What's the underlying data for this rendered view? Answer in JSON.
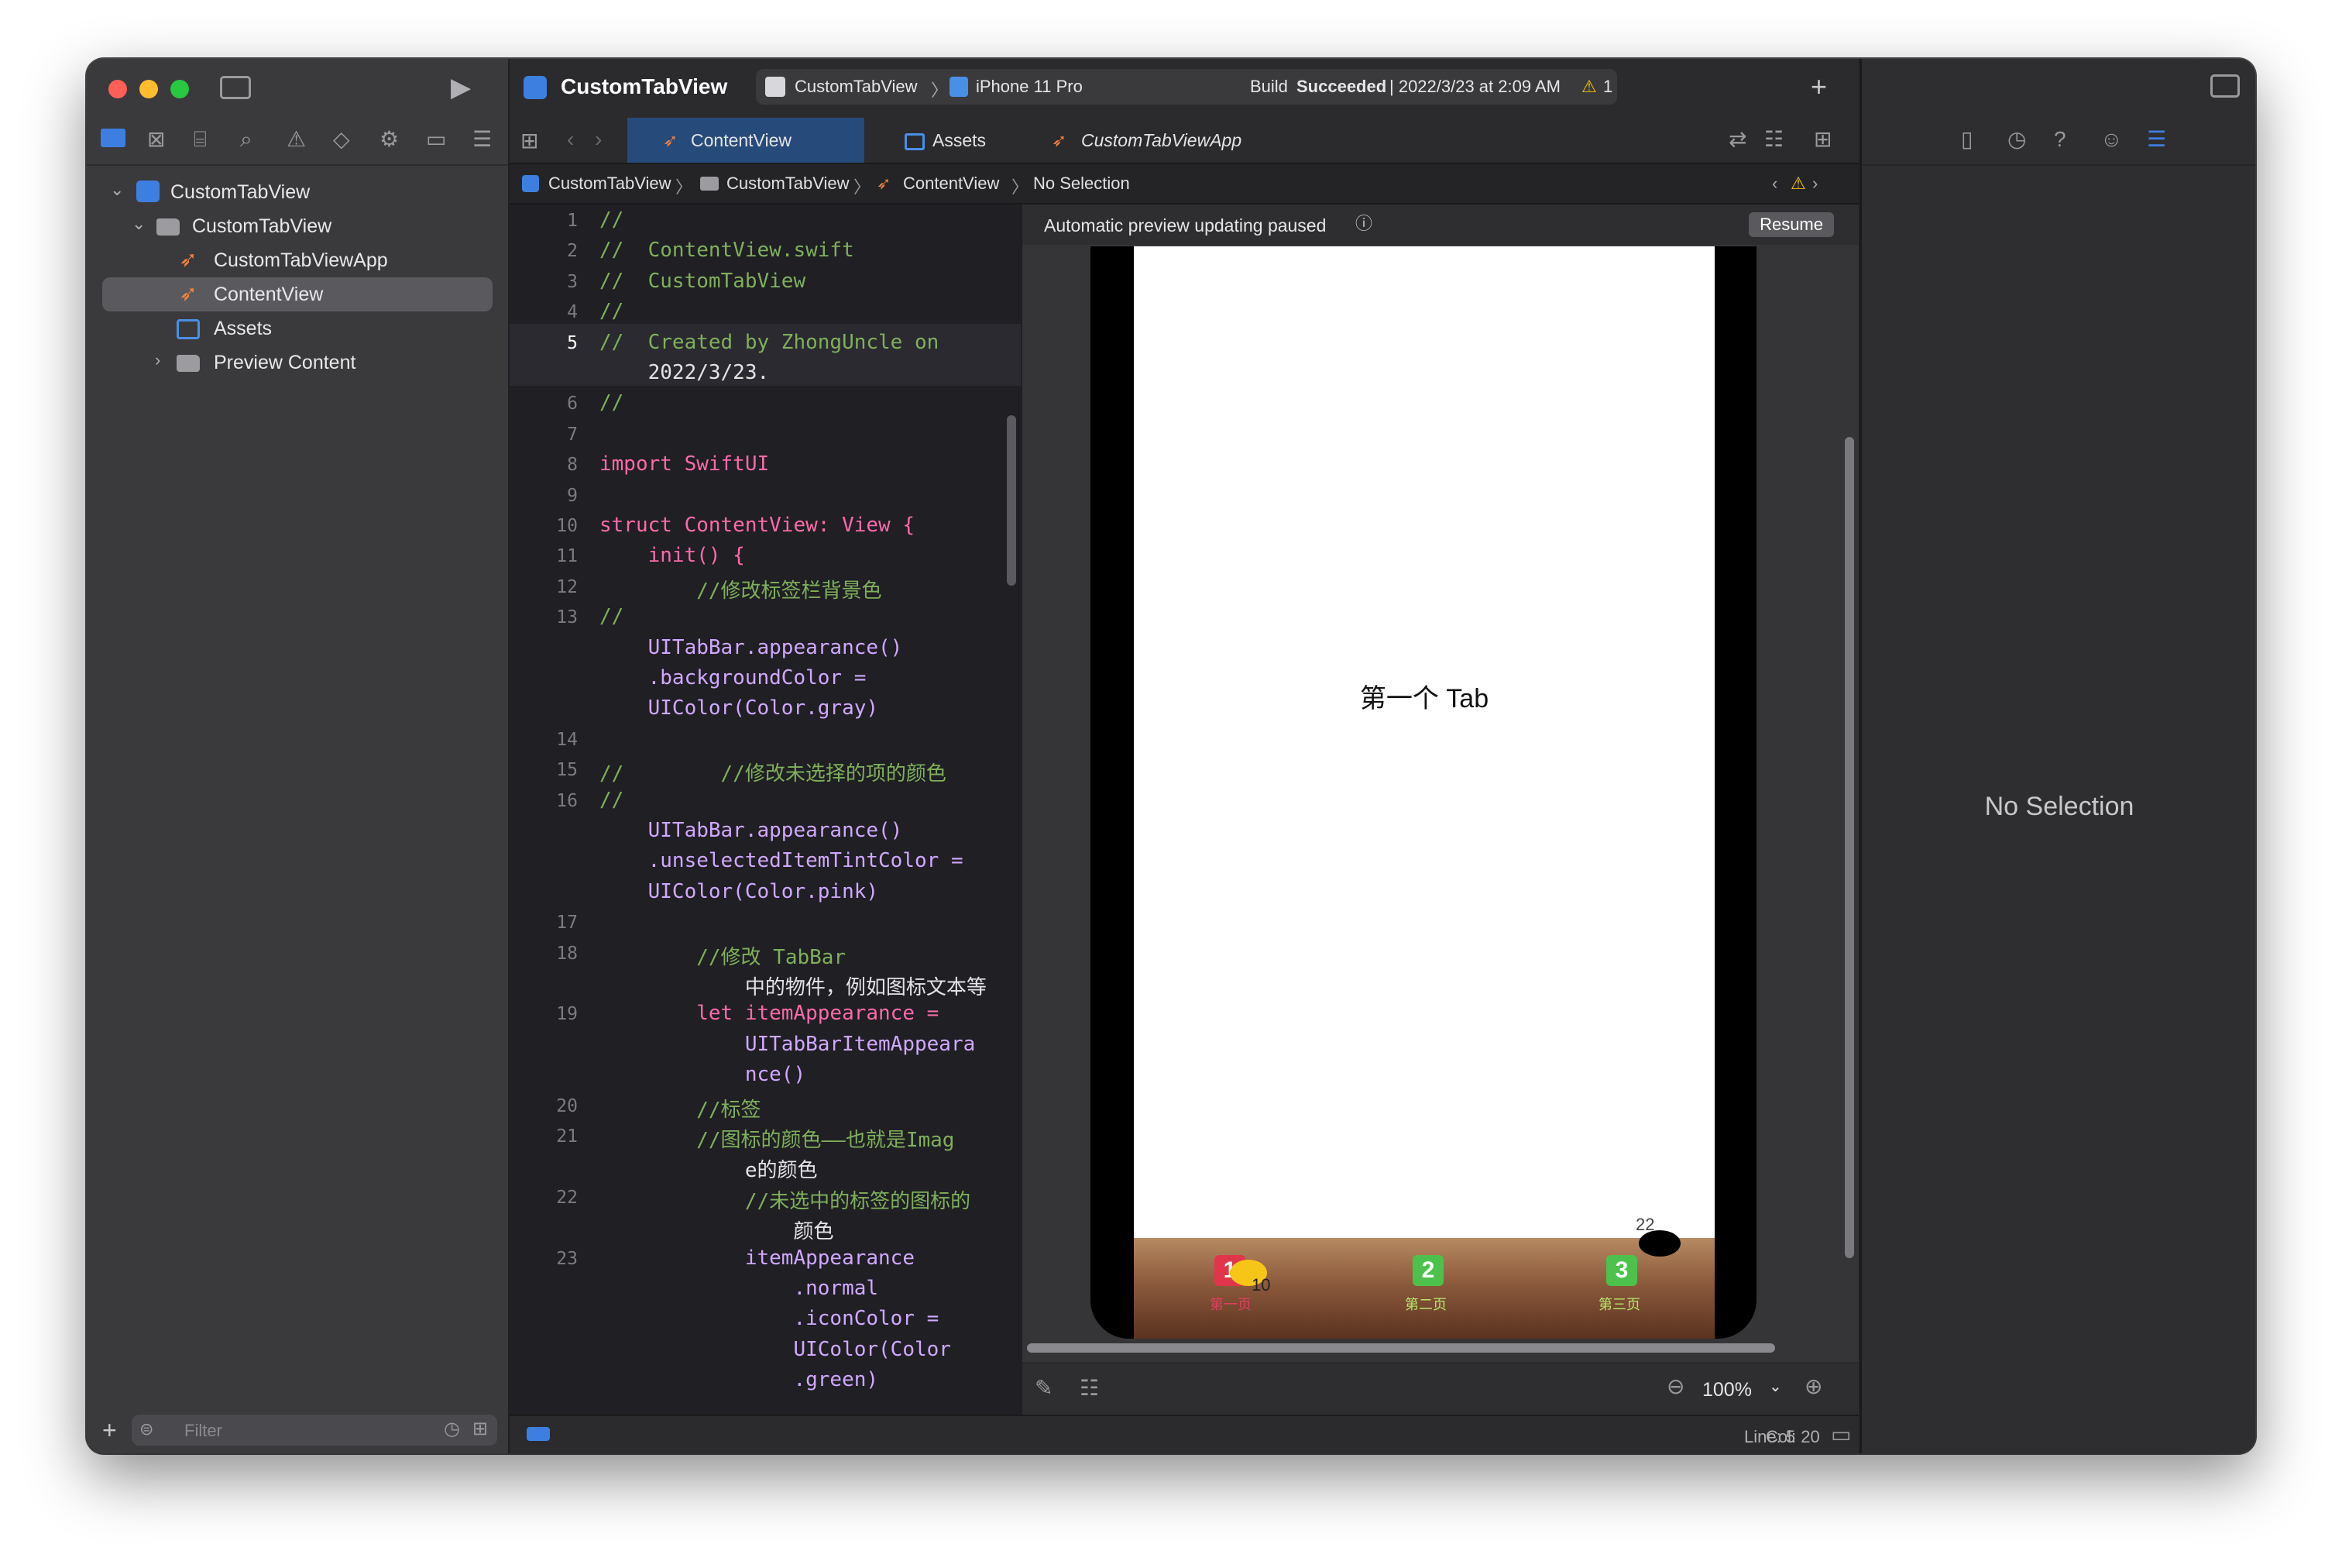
{
  "window": {
    "traffic_lights": {
      "close": "#ff5f57",
      "minimize": "#febc2e",
      "zoom": "#28c840"
    }
  },
  "navigator": {
    "tabs": [
      "folder-icon",
      "source-control-icon",
      "symbol-icon",
      "search-icon",
      "issue-icon",
      "test-icon",
      "debug-icon",
      "breakpoint-icon",
      "report-icon"
    ],
    "items": [
      {
        "label": "CustomTabView",
        "type": "project",
        "expanded": true
      },
      {
        "label": "CustomTabView",
        "type": "folder",
        "expanded": true
      },
      {
        "label": "CustomTabViewApp",
        "type": "swift"
      },
      {
        "label": "ContentView",
        "type": "swift",
        "selected": true
      },
      {
        "label": "Assets",
        "type": "assets"
      },
      {
        "label": "Preview Content",
        "type": "folder",
        "expanded": false
      }
    ],
    "filter_placeholder": "Filter"
  },
  "toolbar": {
    "project_title": "CustomTabView",
    "scheme": "CustomTabView",
    "device": "iPhone 11 Pro",
    "build_status_prefix": "Build",
    "build_status_bold": "Succeeded",
    "build_time": "| 2022/3/23 at 2:09 AM",
    "warnings_count": "1"
  },
  "editor_tabs": [
    {
      "label": "ContentView",
      "active": true
    },
    {
      "label": "Assets",
      "active": false
    },
    {
      "label": "CustomTabViewApp",
      "active": false
    }
  ],
  "jump_bar": [
    "CustomTabView",
    "CustomTabView",
    "ContentView",
    "No Selection"
  ],
  "code_lines": [
    {
      "n": "1",
      "t": "//"
    },
    {
      "n": "2",
      "t": "//  ContentView.swift"
    },
    {
      "n": "3",
      "t": "//  CustomTabView"
    },
    {
      "n": "4",
      "t": "//"
    },
    {
      "n": "5",
      "t": "//  Created by ZhongUncle on"
    },
    {
      "n": "",
      "t": "    2022/3/23."
    },
    {
      "n": "6",
      "t": "//"
    },
    {
      "n": "7",
      "t": ""
    },
    {
      "n": "8",
      "t": "import SwiftUI"
    },
    {
      "n": "9",
      "t": ""
    },
    {
      "n": "10",
      "t": "struct ContentView: View {"
    },
    {
      "n": "11",
      "t": "    init() {"
    },
    {
      "n": "12",
      "t": "        //修改标签栏背景色"
    },
    {
      "n": "13",
      "t": "//"
    },
    {
      "n": "",
      "t": "    UITabBar.appearance()"
    },
    {
      "n": "",
      "t": "    .backgroundColor ="
    },
    {
      "n": "",
      "t": "    UIColor(Color.gray)"
    },
    {
      "n": "14",
      "t": ""
    },
    {
      "n": "15",
      "t": "//        //修改未选择的项的颜色"
    },
    {
      "n": "16",
      "t": "//"
    },
    {
      "n": "",
      "t": "    UITabBar.appearance()"
    },
    {
      "n": "",
      "t": "    .unselectedItemTintColor ="
    },
    {
      "n": "",
      "t": "    UIColor(Color.pink)"
    },
    {
      "n": "17",
      "t": ""
    },
    {
      "n": "18",
      "t": "        //修改 TabBar"
    },
    {
      "n": "",
      "t": "            中的物件，例如图标文本等"
    },
    {
      "n": "19",
      "t": "        let itemAppearance ="
    },
    {
      "n": "",
      "t": "            UITabBarItemAppeara"
    },
    {
      "n": "",
      "t": "            nce()"
    },
    {
      "n": "20",
      "t": "        //标签"
    },
    {
      "n": "21",
      "t": "        //图标的颜色——也就是Imag"
    },
    {
      "n": "",
      "t": "            e的颜色"
    },
    {
      "n": "22",
      "t": "            //未选中的标签的图标的"
    },
    {
      "n": "",
      "t": "                颜色"
    },
    {
      "n": "23",
      "t": "            itemAppearance"
    },
    {
      "n": "",
      "t": "                .normal"
    },
    {
      "n": "",
      "t": "                .iconColor ="
    },
    {
      "n": "",
      "t": "                UIColor(Color"
    },
    {
      "n": "",
      "t": "                .green)"
    }
  ],
  "preview": {
    "paused_message": "Automatic preview updating paused",
    "resume_label": "Resume",
    "screen_text": "第一个 Tab",
    "tab_items": [
      {
        "badge": "1",
        "label": "第一页",
        "color": "#e0354a"
      },
      {
        "badge": "2",
        "label": "第二页",
        "color": "#4cc24c"
      },
      {
        "badge": "3",
        "label": "第三页",
        "color": "#4cc24c"
      }
    ],
    "badge_counts": [
      "10",
      "22"
    ],
    "zoom": "100%"
  },
  "status_bar": {
    "line": "Line: 5",
    "col": "Col: 20"
  },
  "inspector": {
    "empty_text": "No Selection"
  }
}
